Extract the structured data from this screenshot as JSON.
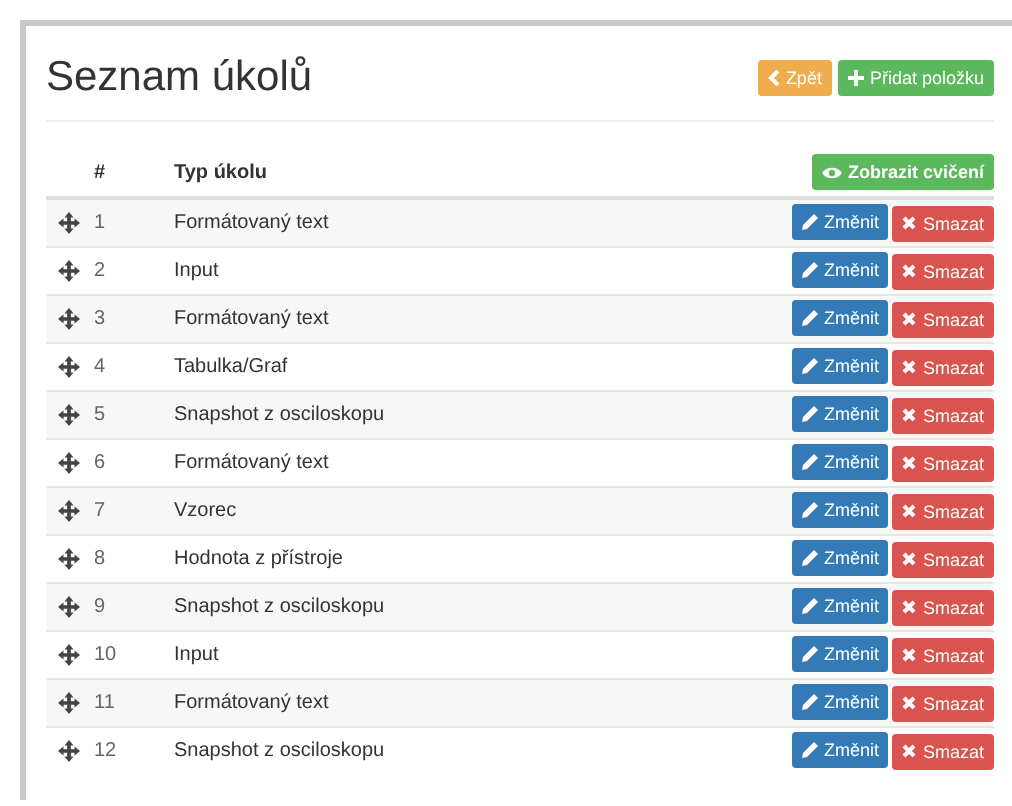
{
  "title": "Seznam úkolů",
  "header_buttons": [
    {
      "kind": "back",
      "label": "Zpět"
    },
    {
      "kind": "add",
      "label": "Přidat položku"
    }
  ],
  "table": {
    "columns": [
      "#",
      "Typ úkolu"
    ],
    "show_button": "Zobrazit cvičení",
    "rows": [
      {
        "number": "1",
        "type": "Formátovaný text",
        "edit": "Změnit",
        "delete": "Smazat"
      },
      {
        "number": "2",
        "type": "Input",
        "edit": "Změnit",
        "delete": "Smazat"
      },
      {
        "number": "3",
        "type": "Formátovaný text",
        "edit": "Změnit",
        "delete": "Smazat"
      },
      {
        "number": "4",
        "type": "Tabulka/Graf",
        "edit": "Změnit",
        "delete": "Smazat"
      },
      {
        "number": "5",
        "type": "Snapshot z osciloskopu",
        "edit": "Změnit",
        "delete": "Smazat"
      },
      {
        "number": "6",
        "type": "Formátovaný text",
        "edit": "Změnit",
        "delete": "Smazat"
      },
      {
        "number": "7",
        "type": "Vzorec",
        "edit": "Změnit",
        "delete": "Smazat"
      },
      {
        "number": "8",
        "type": "Hodnota z přístroje",
        "edit": "Změnit",
        "delete": "Smazat"
      },
      {
        "number": "9",
        "type": "Snapshot z osciloskopu",
        "edit": "Změnit",
        "delete": "Smazat"
      },
      {
        "number": "10",
        "type": "Input",
        "edit": "Změnit",
        "delete": "Smazat"
      },
      {
        "number": "11",
        "type": "Formátovaný text",
        "edit": "Změnit",
        "delete": "Smazat"
      },
      {
        "number": "12",
        "type": "Snapshot z osciloskopu",
        "edit": "Změnit",
        "delete": "Smazat"
      }
    ]
  }
}
